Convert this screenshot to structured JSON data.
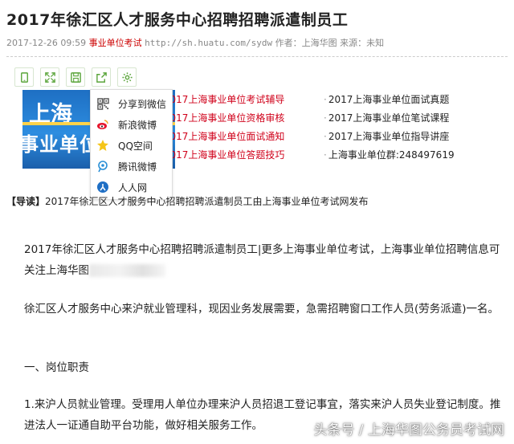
{
  "article": {
    "title": "2017年徐汇区人才服务中心招聘招聘派遣制员工",
    "meta": {
      "datetime": "2017-12-26 09:59",
      "category": "事业单位考试",
      "url": "http://sh.huatu.com/sydw",
      "author_label": "作者：",
      "author": "上海华图",
      "source_label": "来源：",
      "source": "未知"
    }
  },
  "toolbar": {
    "icons": [
      "phone-icon",
      "fullscreen-icon",
      "save-icon",
      "export-icon",
      "settings-icon"
    ]
  },
  "banner": {
    "line1": "上海",
    "line2": "事业单位面试"
  },
  "links": [
    {
      "left": "2017上海事业单位考试辅导",
      "right": "2017上海事业单位面试真题"
    },
    {
      "left": "2017上海事业单位资格审核",
      "right": "2017上海事业单位笔试课程"
    },
    {
      "left": "2017上海事业单位面试通知",
      "right": "2017上海事业单位指导讲座"
    },
    {
      "left": "2017上海事业单位答题技巧",
      "right": "上海事业单位群:248497619"
    }
  ],
  "share_menu": {
    "items": [
      {
        "label": "分享到微信",
        "icon": "qr-code-icon"
      },
      {
        "label": "新浪微博",
        "icon": "weibo-icon"
      },
      {
        "label": "QQ空间",
        "icon": "qzone-star-icon"
      },
      {
        "label": "腾讯微博",
        "icon": "tencent-weibo-icon"
      },
      {
        "label": "人人网",
        "icon": "renren-icon"
      }
    ]
  },
  "lead": {
    "tag": "【导读】",
    "text": "2017年徐汇区人才服务中心招聘招聘派遣制员工由上海事业单位考试网发布"
  },
  "body": {
    "p1": "2017年徐汇区人才服务中心招聘招聘派遣制员工|更多上海事业单位考试，上海事业单位招聘信息可关注上海华图",
    "p2": "徐汇区人才服务中心来沪就业管理科，现因业务发展需要，急需招聘窗口工作人员(劳务派遣)一名。",
    "p3": "一、岗位职责",
    "p4": "1.来沪人员就业管理。受理用人单位办理来沪人员招退工登记事宜，落实来沪人员失业登记制度。推进法人一证通自助平台功能，做好相关服务工作。"
  },
  "watermark": "头条号 / 上海华图公务员考试网",
  "colors": {
    "link_red": "#d0021b",
    "meta_red": "#cc0000",
    "banner_blue": "#2d8de0"
  }
}
